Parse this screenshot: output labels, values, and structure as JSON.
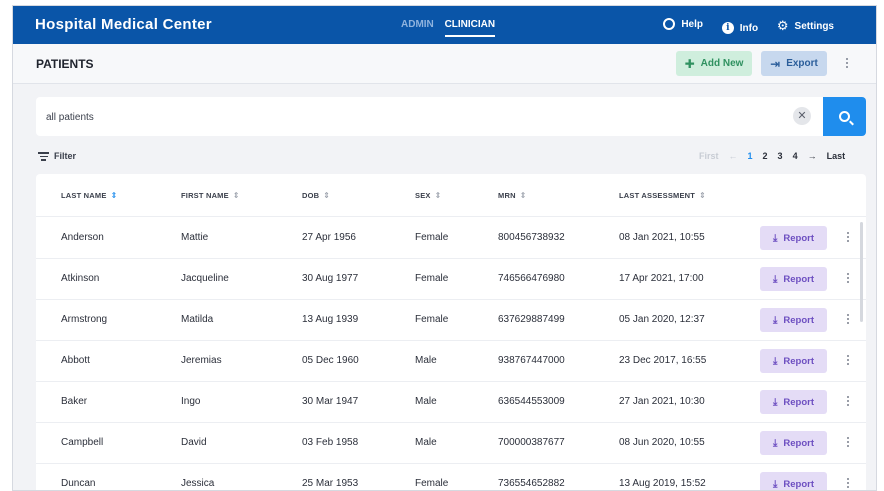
{
  "app": {
    "title": "Hospital Medical Center",
    "roles": [
      {
        "label": "ADMIN",
        "active": false
      },
      {
        "label": "CLINICIAN",
        "active": true
      }
    ],
    "nav": {
      "help": "Help",
      "info": "Info",
      "settings": "Settings"
    }
  },
  "page": {
    "title": "PATIENTS",
    "add_label": "Add New",
    "export_label": "Export"
  },
  "search": {
    "value": "all patients"
  },
  "filter_label": "Filter",
  "pagination": {
    "first": "First",
    "pages": [
      "1",
      "2",
      "3",
      "4"
    ],
    "current": "1",
    "last": "Last"
  },
  "table": {
    "columns": [
      "LAST NAME",
      "FIRST NAME",
      "DOB",
      "SEX",
      "MRN",
      "LAST ASSESSMENT"
    ],
    "report_label": "Report",
    "rows": [
      [
        "Anderson",
        "Mattie",
        "27 Apr 1956",
        "Female",
        "800456738932",
        "08 Jan 2021, 10:55"
      ],
      [
        "Atkinson",
        "Jacqueline",
        "30 Aug 1977",
        "Female",
        "746566476980",
        "17 Apr 2021, 17:00"
      ],
      [
        "Armstrong",
        "Matilda",
        "13 Aug 1939",
        "Female",
        "637629887499",
        "05 Jan 2020, 12:37"
      ],
      [
        "Abbott",
        "Jeremias",
        "05 Dec 1960",
        "Male",
        "938767447000",
        "23 Dec 2017, 16:55"
      ],
      [
        "Baker",
        "Ingo",
        "30 Mar 1947",
        "Male",
        "636544553009",
        "27 Jan 2021, 10:30"
      ],
      [
        "Campbell",
        "David",
        "03 Feb 1958",
        "Male",
        "700000387677",
        "08 Jun 2020, 10:55"
      ],
      [
        "Duncan",
        "Jessica",
        "25 Mar 1953",
        "Female",
        "736554652882",
        "13 Aug 2019, 15:52"
      ]
    ]
  },
  "colors": {
    "topbar": "#0a55a8",
    "accent": "#1f8ded",
    "add_bg": "#cfeedd",
    "export_bg": "#c7d8ee",
    "report_bg": "#e4dcf6"
  }
}
